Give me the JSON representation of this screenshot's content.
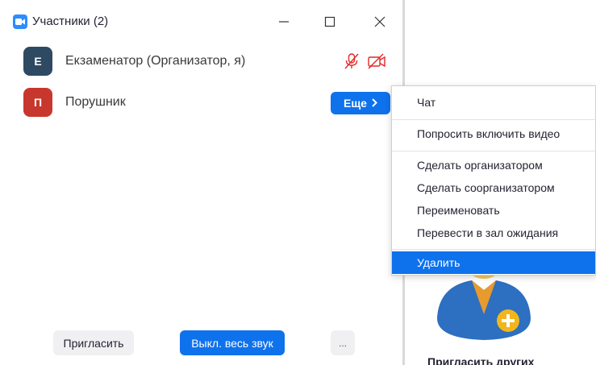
{
  "window": {
    "title": "Участники (2)",
    "accent_color": "#0e72ed",
    "controls": [
      "minimize-icon",
      "maximize-icon",
      "close-icon"
    ]
  },
  "participants": [
    {
      "initial": "Е",
      "name": "Екзаменатор (Организатор, я)",
      "avatar_color": "#2e4a63",
      "mic_muted": true,
      "video_off": true,
      "status_color": "#e02828"
    },
    {
      "initial": "П",
      "name": "Порушник",
      "avatar_color": "#c8372d",
      "more_label": "Еще"
    }
  ],
  "menu": {
    "items": [
      {
        "label": "Чат"
      },
      {
        "label": "Попросить включить видео"
      },
      {
        "label": "Сделать организатором"
      },
      {
        "label": "Сделать соорганизатором"
      },
      {
        "label": "Переименовать"
      },
      {
        "label": "Перевести в зал ожидания"
      },
      {
        "label": "Удалить",
        "selected": true
      }
    ]
  },
  "footer": {
    "invite_label": "Пригласить",
    "mute_all_label": "Выкл. весь звук",
    "more_label": "..."
  },
  "background": {
    "invite_others_label": "Пригласить других"
  }
}
